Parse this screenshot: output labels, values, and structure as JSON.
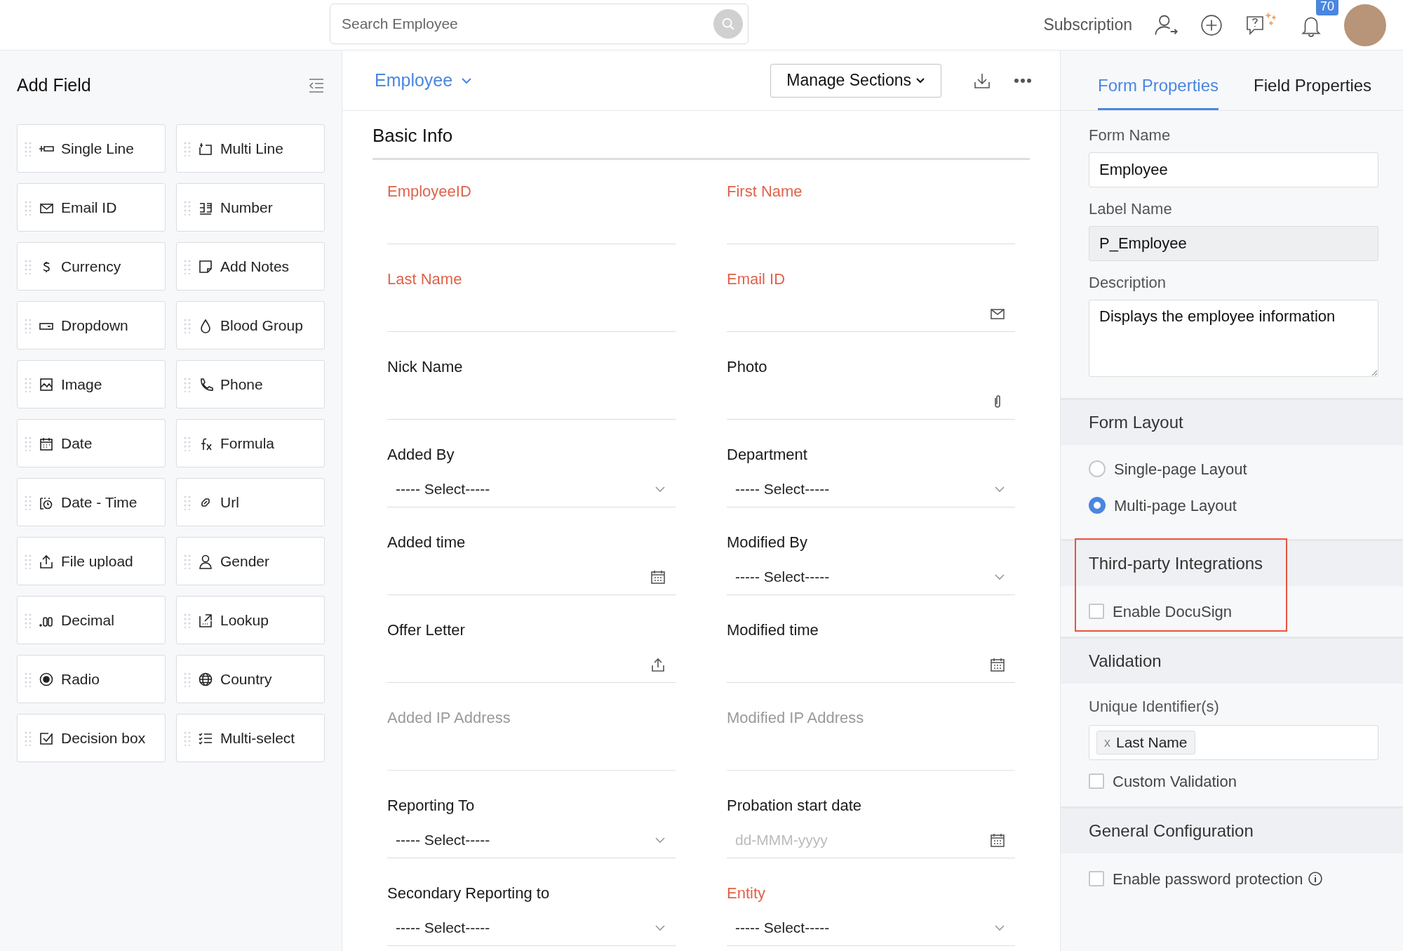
{
  "top_bar": {
    "search": {
      "placeholder": "Search Employee"
    },
    "subscription": "Subscription",
    "notification_count": "70"
  },
  "add_field": {
    "title": "Add Field",
    "tiles": [
      {
        "label": "Single Line"
      },
      {
        "label": "Multi Line"
      },
      {
        "label": "Email ID"
      },
      {
        "label": "Number"
      },
      {
        "label": "Currency"
      },
      {
        "label": "Add Notes"
      },
      {
        "label": "Dropdown"
      },
      {
        "label": "Blood Group"
      },
      {
        "label": "Image"
      },
      {
        "label": "Phone"
      },
      {
        "label": "Date"
      },
      {
        "label": "Formula"
      },
      {
        "label": "Date - Time"
      },
      {
        "label": "Url"
      },
      {
        "label": "File upload"
      },
      {
        "label": "Gender"
      },
      {
        "label": "Decimal"
      },
      {
        "label": "Lookup"
      },
      {
        "label": "Radio"
      },
      {
        "label": "Country"
      },
      {
        "label": "Decision box"
      },
      {
        "label": "Multi-select"
      }
    ]
  },
  "form": {
    "name": "Employee",
    "manage_button": "Manage Sections",
    "section": "Basic Info",
    "fields": [
      {
        "label": "EmployeeID",
        "kind": "text",
        "required": true,
        "read_only": false
      },
      {
        "label": "First Name",
        "kind": "text",
        "required": true,
        "read_only": false
      },
      {
        "label": "Last Name",
        "kind": "text",
        "required": true,
        "read_only": false
      },
      {
        "label": "Email ID",
        "kind": "email",
        "required": true,
        "read_only": false
      },
      {
        "label": "Nick Name",
        "kind": "text",
        "required": false,
        "read_only": false
      },
      {
        "label": "Photo",
        "kind": "attachment",
        "required": false,
        "read_only": false
      },
      {
        "label": "Added By",
        "kind": "select",
        "required": false,
        "read_only": false,
        "value": "----- Select-----"
      },
      {
        "label": "Department",
        "kind": "select",
        "required": false,
        "read_only": false,
        "value": "----- Select-----"
      },
      {
        "label": "Added time",
        "kind": "date",
        "required": false,
        "read_only": false
      },
      {
        "label": "Modified By",
        "kind": "select",
        "required": false,
        "read_only": false,
        "value": "----- Select-----"
      },
      {
        "label": "Offer Letter",
        "kind": "file",
        "required": false,
        "read_only": false
      },
      {
        "label": "Modified time",
        "kind": "date",
        "required": false,
        "read_only": false
      },
      {
        "label": "Added IP Address",
        "kind": "text",
        "required": false,
        "read_only": true
      },
      {
        "label": "Modified IP Address",
        "kind": "text",
        "required": false,
        "read_only": true
      },
      {
        "label": "Reporting To",
        "kind": "select",
        "required": false,
        "read_only": false,
        "value": "----- Select-----"
      },
      {
        "label": "Probation start date",
        "kind": "date",
        "required": false,
        "read_only": false,
        "placeholder": "dd-MMM-yyyy"
      },
      {
        "label": "Secondary Reporting to",
        "kind": "select",
        "required": false,
        "read_only": false,
        "value": "----- Select-----"
      },
      {
        "label": "Entity",
        "kind": "select",
        "required": true,
        "read_only": false,
        "value": "----- Select-----"
      }
    ]
  },
  "properties": {
    "tabs": [
      {
        "label": "Form Properties",
        "selected": true
      },
      {
        "label": "Field Properties",
        "selected": false
      }
    ],
    "form_name": {
      "label": "Form Name",
      "value": "Employee"
    },
    "label_name": {
      "label": "Label Name",
      "value": "P_Employee",
      "disabled": true
    },
    "description": {
      "label": "Description",
      "value": "Displays the employee information"
    },
    "sections": [
      {
        "title": "Form Layout",
        "items": [
          {
            "kind": "radio",
            "label": "Single-page Layout",
            "selected": false
          },
          {
            "kind": "radio",
            "label": "Multi-page Layout",
            "selected": true
          }
        ]
      },
      {
        "title": "Third-party Integrations",
        "highlighted": true,
        "items": [
          {
            "kind": "checkbox",
            "label": "Enable DocuSign",
            "checked": false
          }
        ]
      },
      {
        "title": "Validation",
        "items": [
          {
            "kind": "tags",
            "label": "Unique Identifier(s)",
            "tags": [
              {
                "remove": "x",
                "text": "Last Name"
              }
            ]
          },
          {
            "kind": "checkbox",
            "label": "Custom Validation",
            "checked": false
          }
        ]
      },
      {
        "title": "General Configuration",
        "items": [
          {
            "kind": "checkbox",
            "label": "Enable password protection",
            "checked": false,
            "info": true
          }
        ]
      }
    ]
  }
}
